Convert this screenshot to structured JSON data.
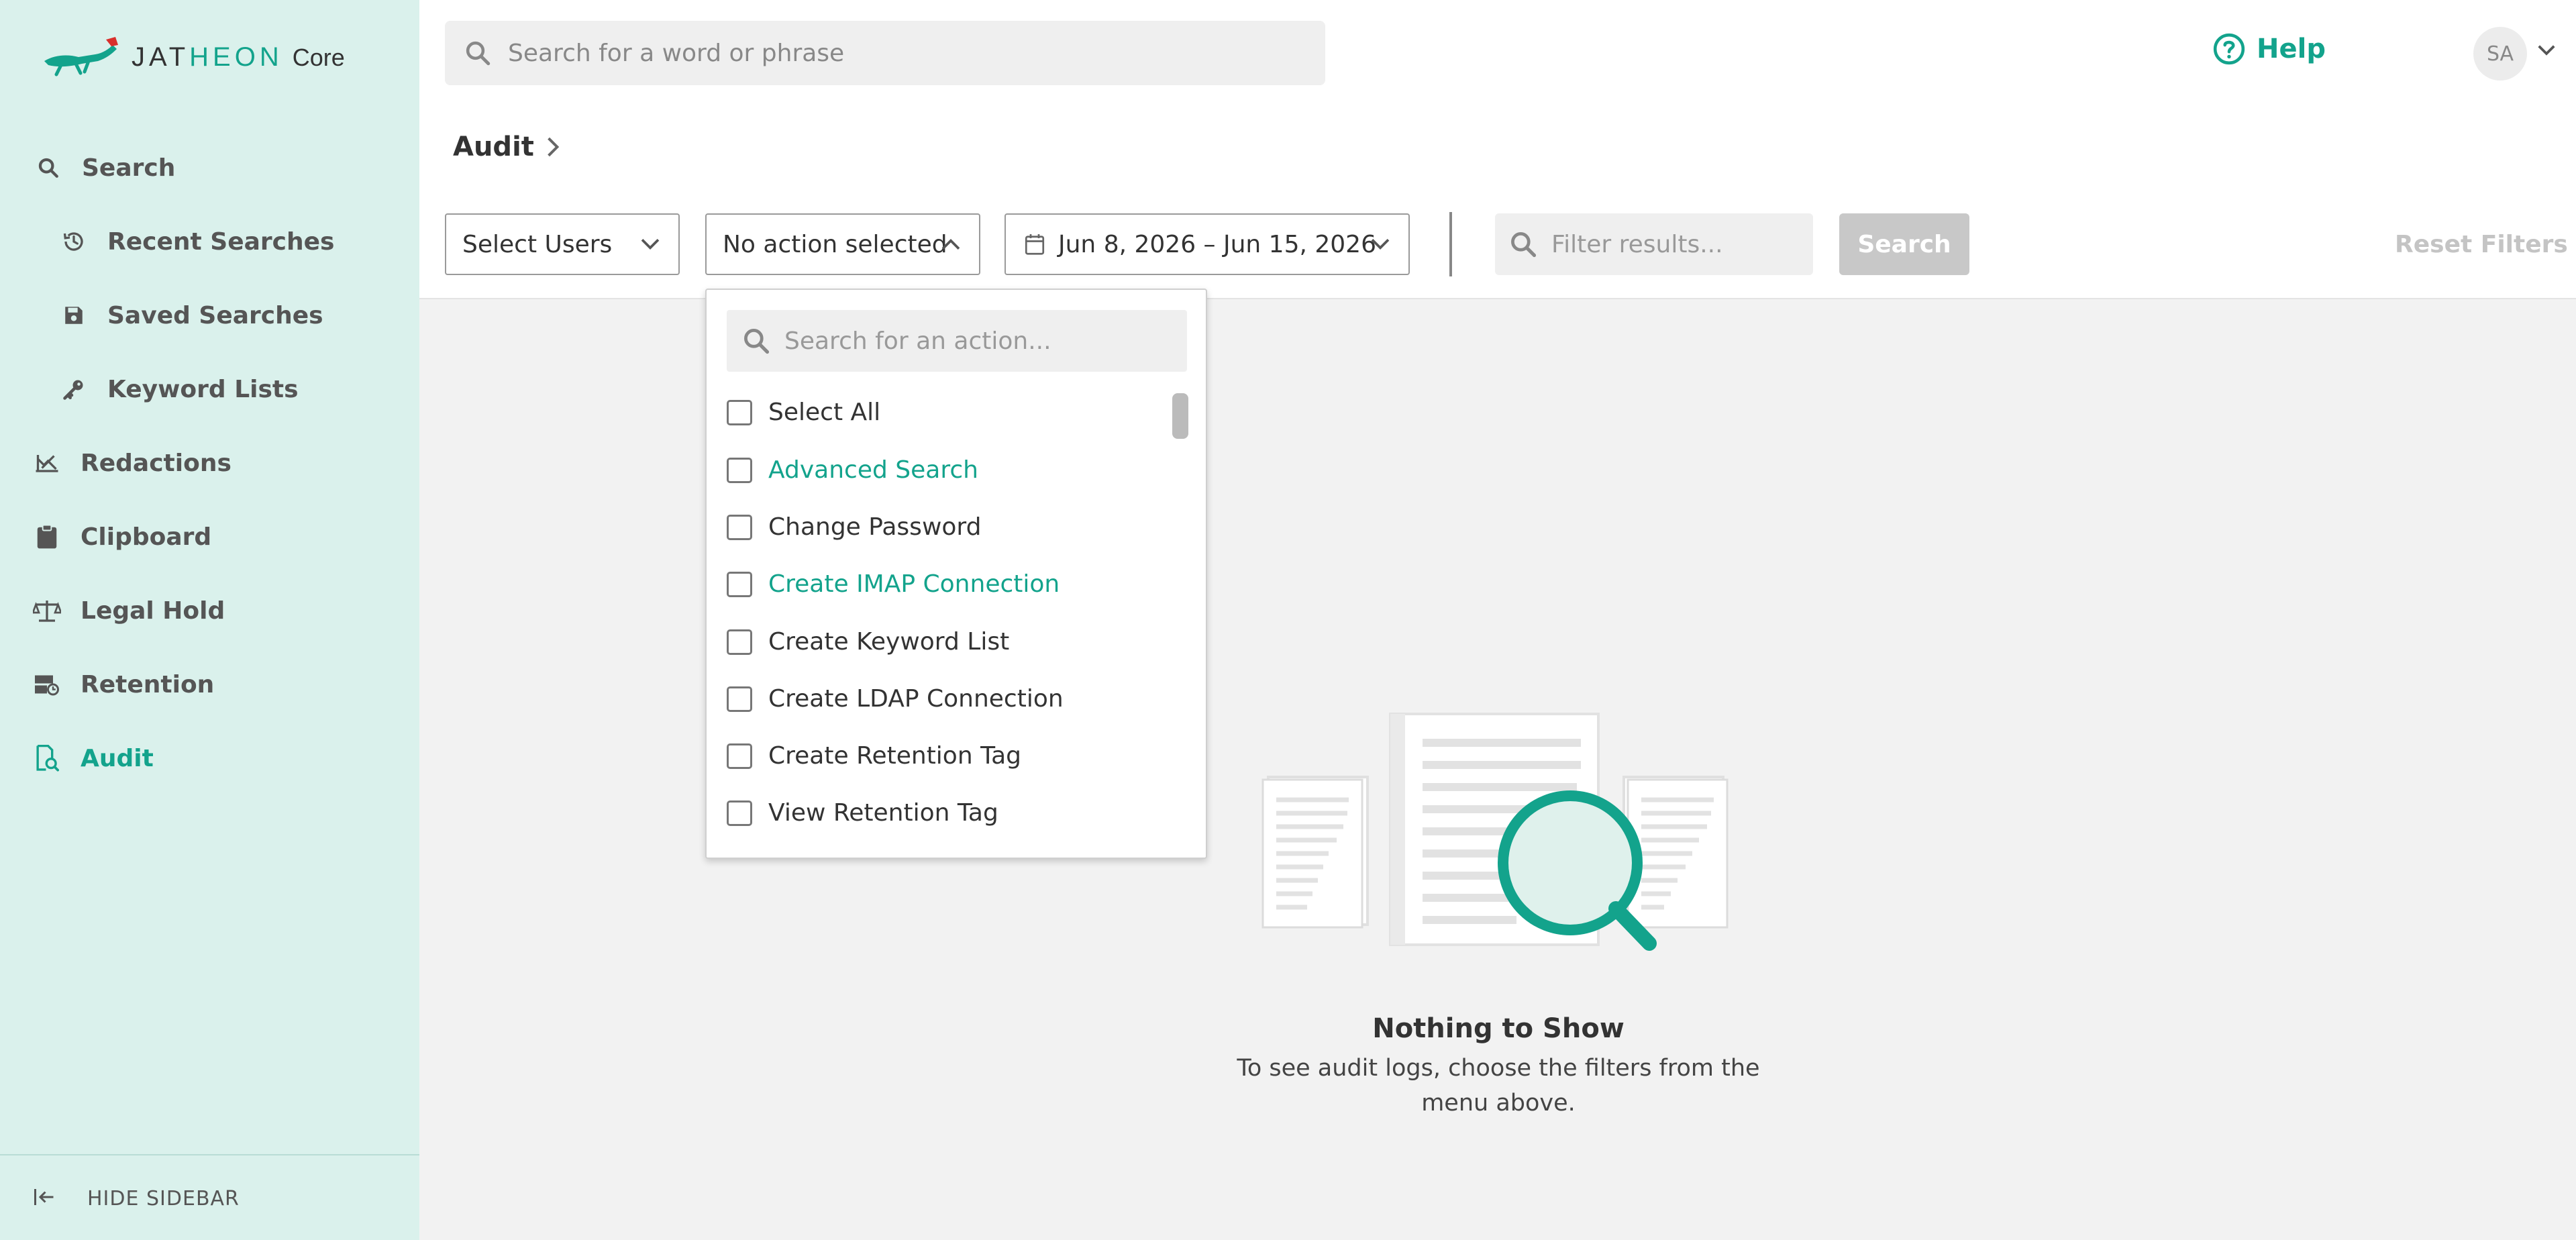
{
  "app": {
    "logo_text_left": "JAT",
    "logo_text_accent": "HEON",
    "logo_suffix": "Core"
  },
  "sidebar": {
    "items": [
      {
        "label": "Search",
        "icon": "search-icon"
      },
      {
        "label": "Recent Searches",
        "icon": "history-icon"
      },
      {
        "label": "Saved Searches",
        "icon": "save-icon"
      },
      {
        "label": "Keyword Lists",
        "icon": "key-icon"
      },
      {
        "label": "Redactions",
        "icon": "redaction-icon"
      },
      {
        "label": "Clipboard",
        "icon": "clipboard-icon"
      },
      {
        "label": "Legal Hold",
        "icon": "scale-icon"
      },
      {
        "label": "Retention",
        "icon": "retention-icon"
      },
      {
        "label": "Audit",
        "icon": "audit-icon",
        "active": true
      }
    ],
    "hide_label": "HIDE SIDEBAR"
  },
  "topbar": {
    "search_placeholder": "Search for a word or phrase",
    "help_label": "Help",
    "avatar_initials": "SA"
  },
  "page": {
    "breadcrumb": "Audit"
  },
  "filters": {
    "users_label": "Select Users",
    "action_label": "No action selected",
    "date_range": "Jun 8, 2026 – Jun 15, 2026",
    "filter_placeholder": "Filter results...",
    "search_button": "Search",
    "reset_button": "Reset Filters"
  },
  "action_dropdown": {
    "search_placeholder": "Search for an action...",
    "options": [
      {
        "label": "Select All",
        "checked": false
      },
      {
        "label": "Advanced Search",
        "checked": false
      },
      {
        "label": "Change Password",
        "checked": false
      },
      {
        "label": "Create IMAP Connection",
        "checked": false
      },
      {
        "label": "Create Keyword List",
        "checked": false
      },
      {
        "label": "Create LDAP Connection",
        "checked": false
      },
      {
        "label": "Create Retention Tag",
        "checked": false
      },
      {
        "label": "View Retention Tag",
        "checked": false
      }
    ]
  },
  "empty_state": {
    "title": "Nothing to Show",
    "description": "To see audit logs, choose the filters from the menu above."
  },
  "colors": {
    "accent": "#13a38c",
    "sidebar_bg": "#daf1ec",
    "content_bg": "#f2f2f2"
  }
}
